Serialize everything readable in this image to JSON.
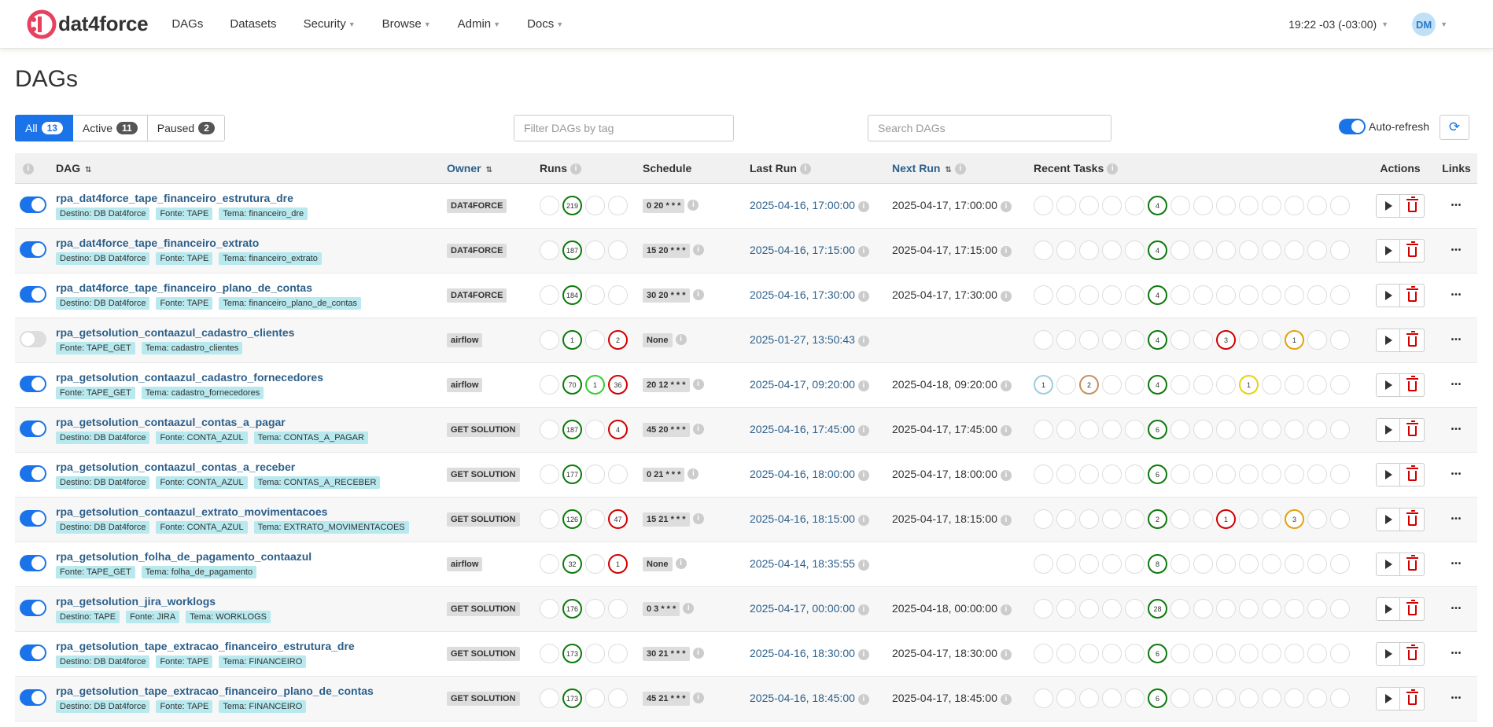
{
  "app": {
    "name": "dat4force"
  },
  "nav": {
    "items": [
      {
        "label": "DAGs",
        "caret": false
      },
      {
        "label": "Datasets",
        "caret": false
      },
      {
        "label": "Security",
        "caret": true
      },
      {
        "label": "Browse",
        "caret": true
      },
      {
        "label": "Admin",
        "caret": true
      },
      {
        "label": "Docs",
        "caret": true
      }
    ],
    "timezone": "19:22 -03 (-03:00)",
    "avatar_initials": "DM"
  },
  "page": {
    "title": "DAGs"
  },
  "status_tabs": [
    {
      "label": "All",
      "count": "13",
      "active": true
    },
    {
      "label": "Active",
      "count": "11",
      "active": false
    },
    {
      "label": "Paused",
      "count": "2",
      "active": false
    }
  ],
  "filters": {
    "tag_placeholder": "Filter DAGs by tag",
    "search_placeholder": "Search DAGs",
    "auto_refresh_label": "Auto-refresh"
  },
  "table": {
    "headers": {
      "dag": "DAG",
      "owner": "Owner",
      "runs": "Runs",
      "schedule": "Schedule",
      "last_run": "Last Run",
      "next_run": "Next Run",
      "recent_tasks": "Recent Tasks",
      "actions": "Actions",
      "links": "Links"
    },
    "rows": [
      {
        "name": "rpa_dat4force_tape_financeiro_estrutura_dre",
        "active": true,
        "tags": [
          "Destino: DB Dat4force",
          "Fonte: TAPE",
          "Tema: financeiro_dre"
        ],
        "owner": "DAT4FORCE",
        "runs": [
          [
            "",
            ""
          ],
          [
            "219",
            "green"
          ],
          [
            "",
            ""
          ],
          [
            "",
            ""
          ]
        ],
        "schedule": "0 20 * * *",
        "last_run": "2025-04-16, 17:00:00",
        "next_run": "2025-04-17, 17:00:00",
        "tasks": {
          "5": [
            "4",
            "green"
          ]
        }
      },
      {
        "name": "rpa_dat4force_tape_financeiro_extrato",
        "active": true,
        "tags": [
          "Destino: DB Dat4force",
          "Fonte: TAPE",
          "Tema: financeiro_extrato"
        ],
        "owner": "DAT4FORCE",
        "runs": [
          [
            "",
            ""
          ],
          [
            "187",
            "green"
          ],
          [
            "",
            ""
          ],
          [
            "",
            ""
          ]
        ],
        "schedule": "15 20 * * *",
        "last_run": "2025-04-16, 17:15:00",
        "next_run": "2025-04-17, 17:15:00",
        "tasks": {
          "5": [
            "4",
            "green"
          ]
        }
      },
      {
        "name": "rpa_dat4force_tape_financeiro_plano_de_contas",
        "active": true,
        "tags": [
          "Destino: DB Dat4force",
          "Fonte: TAPE",
          "Tema: financeiro_plano_de_contas"
        ],
        "owner": "DAT4FORCE",
        "runs": [
          [
            "",
            ""
          ],
          [
            "184",
            "green"
          ],
          [
            "",
            ""
          ],
          [
            "",
            ""
          ]
        ],
        "schedule": "30 20 * * *",
        "last_run": "2025-04-16, 17:30:00",
        "next_run": "2025-04-17, 17:30:00",
        "tasks": {
          "5": [
            "4",
            "green"
          ]
        }
      },
      {
        "name": "rpa_getsolution_contaazul_cadastro_clientes",
        "active": false,
        "tags": [
          "Fonte: TAPE_GET",
          "Tema: cadastro_clientes"
        ],
        "owner": "airflow",
        "runs": [
          [
            "",
            ""
          ],
          [
            "1",
            "green"
          ],
          [
            "",
            ""
          ],
          [
            "2",
            "red"
          ]
        ],
        "schedule": "None",
        "last_run": "2025-01-27, 13:50:43",
        "next_run": "",
        "tasks": {
          "5": [
            "4",
            "green"
          ],
          "8": [
            "3",
            "red"
          ],
          "11": [
            "1",
            "orange"
          ]
        }
      },
      {
        "name": "rpa_getsolution_contaazul_cadastro_fornecedores",
        "active": true,
        "tags": [
          "Fonte: TAPE_GET",
          "Tema: cadastro_fornecedores"
        ],
        "owner": "airflow",
        "runs": [
          [
            "",
            ""
          ],
          [
            "70",
            "green"
          ],
          [
            "1",
            "lime"
          ],
          [
            "36",
            "red"
          ]
        ],
        "schedule": "20 12 * * *",
        "last_run": "2025-04-17, 09:20:00",
        "next_run": "2025-04-18, 09:20:00",
        "tasks": {
          "0": [
            "1",
            "lightblue"
          ],
          "2": [
            "2",
            "tan"
          ],
          "5": [
            "4",
            "green"
          ],
          "9": [
            "1",
            "yellow"
          ]
        }
      },
      {
        "name": "rpa_getsolution_contaazul_contas_a_pagar",
        "active": true,
        "tags": [
          "Destino: DB Dat4force",
          "Fonte: CONTA_AZUL",
          "Tema: CONTAS_A_PAGAR"
        ],
        "owner": "GET SOLUTION",
        "runs": [
          [
            "",
            ""
          ],
          [
            "187",
            "green"
          ],
          [
            "",
            ""
          ],
          [
            "4",
            "red"
          ]
        ],
        "schedule": "45 20 * * *",
        "last_run": "2025-04-16, 17:45:00",
        "next_run": "2025-04-17, 17:45:00",
        "tasks": {
          "5": [
            "6",
            "green"
          ]
        }
      },
      {
        "name": "rpa_getsolution_contaazul_contas_a_receber",
        "active": true,
        "tags": [
          "Destino: DB Dat4force",
          "Fonte: CONTA_AZUL",
          "Tema: CONTAS_A_RECEBER"
        ],
        "owner": "GET SOLUTION",
        "runs": [
          [
            "",
            ""
          ],
          [
            "177",
            "green"
          ],
          [
            "",
            ""
          ],
          [
            "",
            ""
          ]
        ],
        "schedule": "0 21 * * *",
        "last_run": "2025-04-16, 18:00:00",
        "next_run": "2025-04-17, 18:00:00",
        "tasks": {
          "5": [
            "6",
            "green"
          ]
        }
      },
      {
        "name": "rpa_getsolution_contaazul_extrato_movimentacoes",
        "active": true,
        "tags": [
          "Destino: DB Dat4force",
          "Fonte: CONTA_AZUL",
          "Tema: EXTRATO_MOVIMENTACOES"
        ],
        "owner": "GET SOLUTION",
        "runs": [
          [
            "",
            ""
          ],
          [
            "126",
            "green"
          ],
          [
            "",
            ""
          ],
          [
            "47",
            "red"
          ]
        ],
        "schedule": "15 21 * * *",
        "last_run": "2025-04-16, 18:15:00",
        "next_run": "2025-04-17, 18:15:00",
        "tasks": {
          "5": [
            "2",
            "green"
          ],
          "8": [
            "1",
            "red"
          ],
          "11": [
            "3",
            "orange"
          ]
        }
      },
      {
        "name": "rpa_getsolution_folha_de_pagamento_contaazul",
        "active": true,
        "tags": [
          "Fonte: TAPE_GET",
          "Tema: folha_de_pagamento"
        ],
        "owner": "airflow",
        "runs": [
          [
            "",
            ""
          ],
          [
            "32",
            "green"
          ],
          [
            "",
            ""
          ],
          [
            "1",
            "red"
          ]
        ],
        "schedule": "None",
        "last_run": "2025-04-14, 18:35:55",
        "next_run": "",
        "tasks": {
          "5": [
            "8",
            "green"
          ]
        }
      },
      {
        "name": "rpa_getsolution_jira_worklogs",
        "active": true,
        "tags": [
          "Destino: TAPE",
          "Fonte: JIRA",
          "Tema: WORKLOGS"
        ],
        "owner": "GET SOLUTION",
        "runs": [
          [
            "",
            ""
          ],
          [
            "176",
            "green"
          ],
          [
            "",
            ""
          ],
          [
            "",
            ""
          ]
        ],
        "schedule": "0 3 * * *",
        "last_run": "2025-04-17, 00:00:00",
        "next_run": "2025-04-18, 00:00:00",
        "tasks": {
          "5": [
            "28",
            "green"
          ]
        }
      },
      {
        "name": "rpa_getsolution_tape_extracao_financeiro_estrutura_dre",
        "active": true,
        "tags": [
          "Destino: DB Dat4force",
          "Fonte: TAPE",
          "Tema: FINANCEIRO"
        ],
        "owner": "GET SOLUTION",
        "runs": [
          [
            "",
            ""
          ],
          [
            "173",
            "green"
          ],
          [
            "",
            ""
          ],
          [
            "",
            ""
          ]
        ],
        "schedule": "30 21 * * *",
        "last_run": "2025-04-16, 18:30:00",
        "next_run": "2025-04-17, 18:30:00",
        "tasks": {
          "5": [
            "6",
            "green"
          ]
        }
      },
      {
        "name": "rpa_getsolution_tape_extracao_financeiro_plano_de_contas",
        "active": true,
        "tags": [
          "Destino: DB Dat4force",
          "Fonte: TAPE",
          "Tema: FINANCEIRO"
        ],
        "owner": "GET SOLUTION",
        "runs": [
          [
            "",
            ""
          ],
          [
            "173",
            "green"
          ],
          [
            "",
            ""
          ],
          [
            "",
            ""
          ]
        ],
        "schedule": "45 21 * * *",
        "last_run": "2025-04-16, 18:45:00",
        "next_run": "2025-04-17, 18:45:00",
        "tasks": {
          "5": [
            "6",
            "green"
          ]
        }
      }
    ]
  },
  "colors": {
    "accent": "#1a73e8",
    "link": "#2c5f8a",
    "success": "#0b7a0b",
    "failed": "#d10000",
    "upstream_failed": "#e4a00f",
    "tag_bg": "#b7e9ef"
  },
  "icons": {
    "logo": "dat4force-logo-icon",
    "info": "info-icon",
    "sort": "sort-icon",
    "refresh": "refresh-icon",
    "trigger": "play-icon",
    "delete": "trash-icon",
    "more": "more-icon"
  }
}
